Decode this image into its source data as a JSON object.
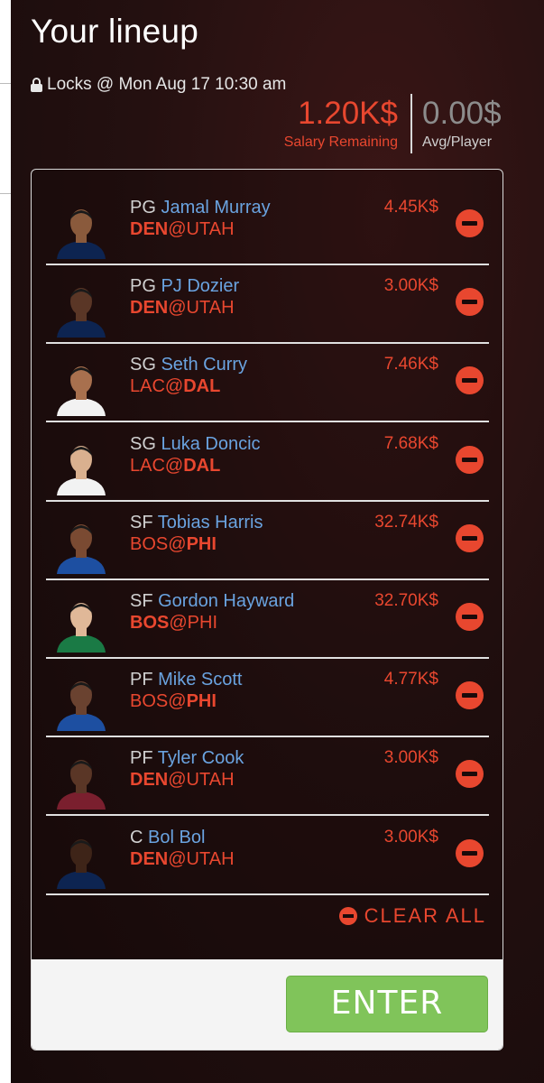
{
  "header": {
    "title": "Your lineup",
    "locks_text": "Locks @ Mon Aug 17 10:30 am"
  },
  "summary": {
    "salary_remaining_value": "1.20K$",
    "salary_remaining_label": "Salary Remaining",
    "avg_player_value": "0.00$",
    "avg_player_label": "Avg/Player"
  },
  "colors": {
    "accent_red": "#e8472f",
    "name_blue": "#6aa3e0",
    "enter_green": "#80c45a"
  },
  "players": [
    {
      "pos": "PG",
      "name": "Jamal Murray",
      "away": "DEN",
      "home": "UTAH",
      "bold": "away",
      "salary": "4.45K$",
      "jersey": "#0d2451",
      "skin": "#8a5a3c"
    },
    {
      "pos": "PG",
      "name": "PJ Dozier",
      "away": "DEN",
      "home": "UTAH",
      "bold": "away",
      "salary": "3.00K$",
      "jersey": "#0d2451",
      "skin": "#5a3626"
    },
    {
      "pos": "SG",
      "name": "Seth Curry",
      "away": "LAC",
      "home": "DAL",
      "bold": "home",
      "salary": "7.46K$",
      "jersey": "#f2f2f2",
      "skin": "#a8704e"
    },
    {
      "pos": "SG",
      "name": "Luka Doncic",
      "away": "LAC",
      "home": "DAL",
      "bold": "home",
      "salary": "7.68K$",
      "jersey": "#f2f2f2",
      "skin": "#d9b08f"
    },
    {
      "pos": "SF",
      "name": "Tobias Harris",
      "away": "BOS",
      "home": "PHI",
      "bold": "home",
      "salary": "32.74K$",
      "jersey": "#1d4fa1",
      "skin": "#7a4a32"
    },
    {
      "pos": "SF",
      "name": "Gordon Hayward",
      "away": "BOS",
      "home": "PHI",
      "bold": "away",
      "salary": "32.70K$",
      "jersey": "#1a7a45",
      "skin": "#e0b898"
    },
    {
      "pos": "PF",
      "name": "Mike Scott",
      "away": "BOS",
      "home": "PHI",
      "bold": "home",
      "salary": "4.77K$",
      "jersey": "#1d4fa1",
      "skin": "#6a4230"
    },
    {
      "pos": "PF",
      "name": "Tyler Cook",
      "away": "DEN",
      "home": "UTAH",
      "bold": "away",
      "salary": "3.00K$",
      "jersey": "#7a1f2e",
      "skin": "#5a3626"
    },
    {
      "pos": "C",
      "name": "Bol Bol",
      "away": "DEN",
      "home": "UTAH",
      "bold": "away",
      "salary": "3.00K$",
      "jersey": "#0d2451",
      "skin": "#3e2418"
    }
  ],
  "actions": {
    "clear_all": "CLEAR ALL",
    "enter": "ENTER"
  }
}
